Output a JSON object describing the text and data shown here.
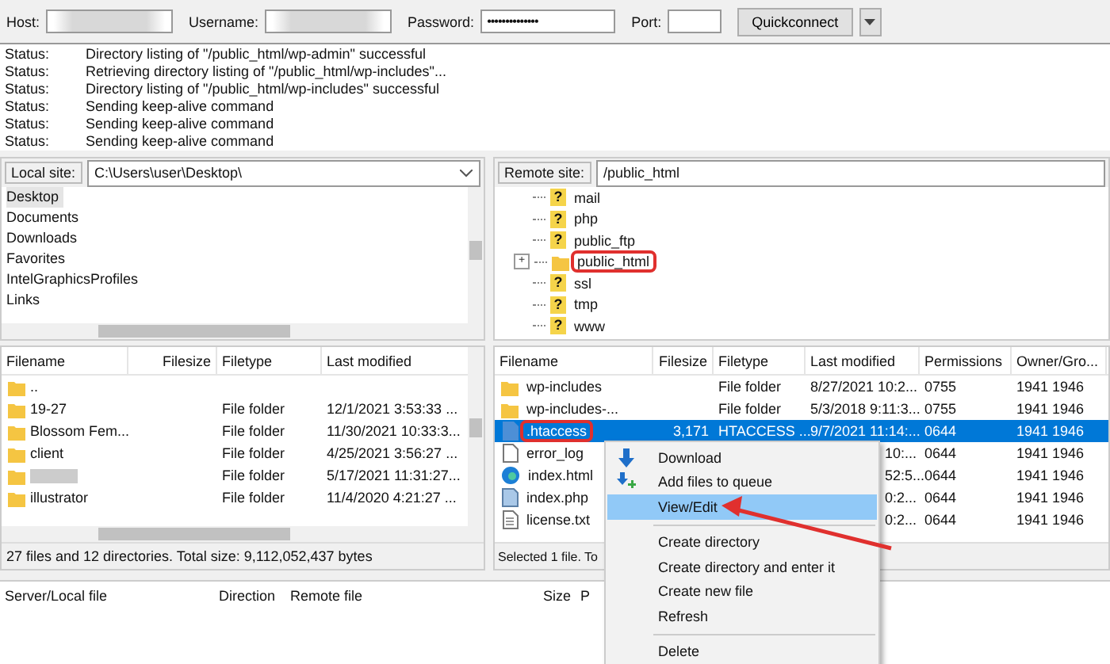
{
  "quickconnect": {
    "host_label": "Host:",
    "username_label": "Username:",
    "password_label": "Password:",
    "password_value": "••••••••••••••",
    "port_label": "Port:",
    "button": "Quickconnect"
  },
  "log": [
    {
      "label": "Status:",
      "message": "Directory listing of \"/public_html/wp-admin\" successful"
    },
    {
      "label": "Status:",
      "message": "Retrieving directory listing of \"/public_html/wp-includes\"..."
    },
    {
      "label": "Status:",
      "message": "Directory listing of \"/public_html/wp-includes\" successful"
    },
    {
      "label": "Status:",
      "message": "Sending keep-alive command"
    },
    {
      "label": "Status:",
      "message": "Sending keep-alive command"
    },
    {
      "label": "Status:",
      "message": "Sending keep-alive command"
    }
  ],
  "local_site": {
    "label": "Local site:",
    "path": "C:\\Users\\user\\Desktop\\"
  },
  "local_tree": [
    {
      "name": "Desktop",
      "selected": true
    },
    {
      "name": "Documents",
      "selected": false
    },
    {
      "name": "Downloads",
      "selected": false
    },
    {
      "name": "Favorites",
      "selected": false
    },
    {
      "name": "IntelGraphicsProfiles",
      "selected": false
    },
    {
      "name": "Links",
      "selected": false
    }
  ],
  "remote_site": {
    "label": "Remote site:",
    "path": "/public_html"
  },
  "remote_tree": [
    {
      "name": "mail",
      "kind": "unknown",
      "glyph": "?",
      "highlighted": false
    },
    {
      "name": "php",
      "kind": "unknown",
      "glyph": "?",
      "highlighted": false
    },
    {
      "name": "public_ftp",
      "kind": "unknown",
      "glyph": "?",
      "highlighted": false
    },
    {
      "name": "public_html",
      "kind": "folder",
      "highlighted": true,
      "expander": "+"
    },
    {
      "name": "ssl",
      "kind": "unknown",
      "glyph": "?",
      "highlighted": false
    },
    {
      "name": "tmp",
      "kind": "unknown",
      "glyph": "?",
      "highlighted": false
    },
    {
      "name": "www",
      "kind": "unknown",
      "glyph": "?",
      "highlighted": false
    }
  ],
  "local_files": {
    "columns": [
      "Filename",
      "Filesize",
      "Filetype",
      "Last modified"
    ],
    "rows": [
      {
        "name": ".."
      },
      {
        "name": "19-27",
        "type": "File folder",
        "modified": "12/1/2021 3:53:33 ..."
      },
      {
        "name": "Blossom Fem...",
        "type": "File folder",
        "modified": "11/30/2021 10:33:3..."
      },
      {
        "name": "client",
        "type": "File folder",
        "modified": "4/25/2021 3:56:27 ..."
      },
      {
        "blurred": true,
        "type": "File folder",
        "modified": "5/17/2021 11:31:27..."
      },
      {
        "name": "illustrator",
        "type": "File folder",
        "modified": "11/4/2020 4:21:27 ..."
      }
    ],
    "status": "27 files and 12 directories. Total size: 9,112,052,437 bytes"
  },
  "remote_files": {
    "columns": [
      "Filename",
      "Filesize",
      "Filetype",
      "Last modified",
      "Permissions",
      "Owner/Gro..."
    ],
    "rows": [
      {
        "name": "wp-includes",
        "kind": "folder",
        "type": "File folder",
        "modified": "8/27/2021 10:2...",
        "permissions": "0755",
        "owner": "1941 1946",
        "selected": false,
        "highlighted": false
      },
      {
        "name": "wp-includes-...",
        "kind": "folder",
        "type": "File folder",
        "modified": "5/3/2018 9:11:3...",
        "permissions": "0755",
        "owner": "1941 1946",
        "selected": false,
        "highlighted": false
      },
      {
        "name": ".htaccess",
        "kind": "config",
        "size": "3,171",
        "type": "HTACCESS ...",
        "modified": "9/7/2021 11:14:...",
        "permissions": "0644",
        "owner": "1941 1946",
        "selected": true,
        "highlighted": true
      },
      {
        "name": "error_log",
        "kind": "file",
        "modified_tail": "10:...",
        "permissions": "0644",
        "owner": "1941 1946",
        "selected": false,
        "highlighted": false
      },
      {
        "name": "index.html",
        "kind": "web",
        "modified_tail": "52:5...",
        "permissions": "0644",
        "owner": "1941 1946",
        "selected": false,
        "highlighted": false
      },
      {
        "name": "index.php",
        "kind": "script",
        "modified_tail": "0:2...",
        "permissions": "0644",
        "owner": "1941 1946",
        "selected": false,
        "highlighted": false
      },
      {
        "name": "license.txt",
        "kind": "text",
        "modified_tail": "0:2...",
        "permissions": "0644",
        "owner": "1941 1946",
        "selected": false,
        "highlighted": false
      }
    ],
    "status": "Selected 1 file. To"
  },
  "queue": {
    "columns": [
      "Server/Local file",
      "Direction",
      "Remote file",
      "Size",
      "P"
    ]
  },
  "context_menu": [
    {
      "kind": "download",
      "label": "Download",
      "selected": false
    },
    {
      "kind": "enqueue",
      "label": "Add files to queue",
      "selected": false
    },
    {
      "kind": "plain",
      "label": "View/Edit",
      "selected": true
    },
    {
      "kind": "separator"
    },
    {
      "kind": "plain",
      "label": "Create directory",
      "selected": false
    },
    {
      "kind": "plain",
      "label": "Create directory and enter it",
      "selected": false
    },
    {
      "kind": "plain",
      "label": "Create new file",
      "selected": false
    },
    {
      "kind": "plain",
      "label": "Refresh",
      "selected": false
    },
    {
      "kind": "separator"
    },
    {
      "kind": "plain",
      "label": "Delete",
      "selected": false
    }
  ]
}
